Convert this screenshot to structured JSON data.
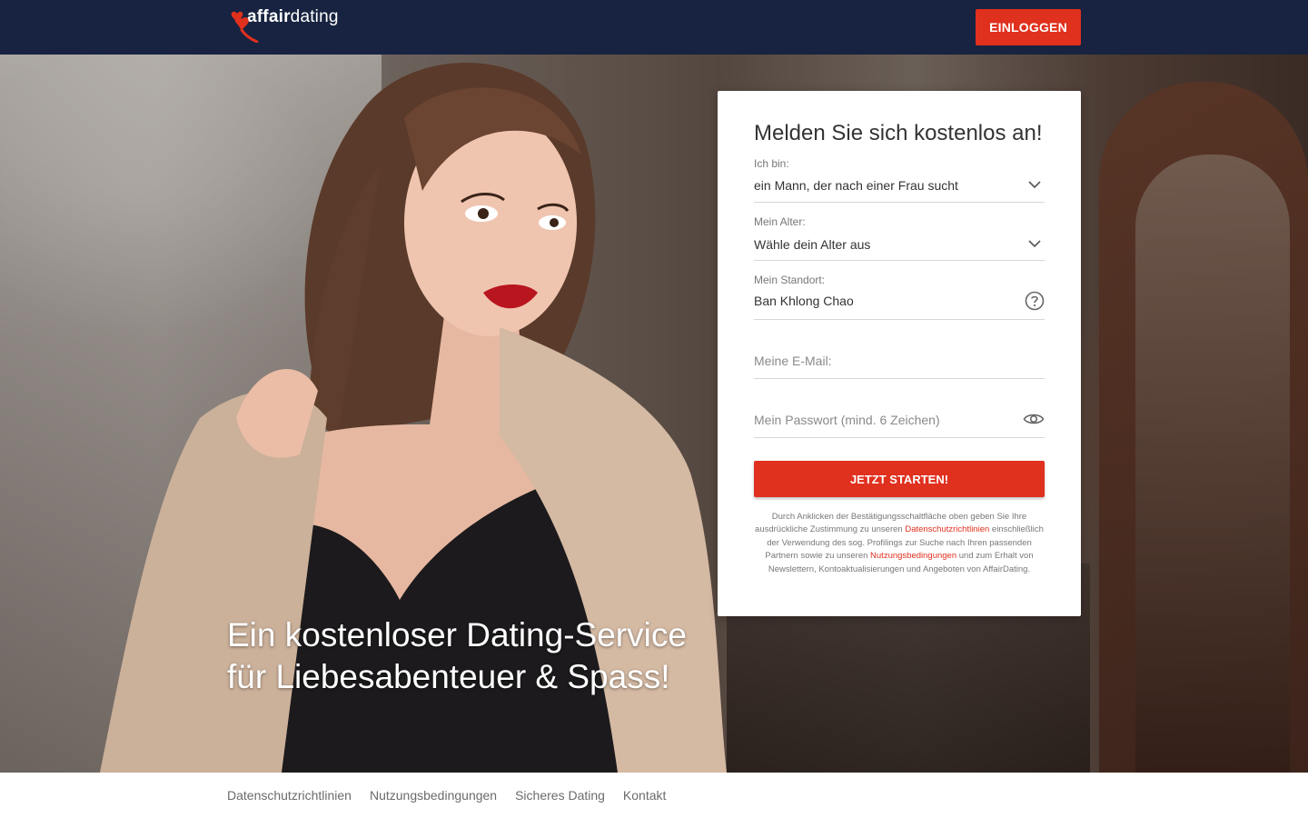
{
  "header": {
    "logo": {
      "brand_bold": "affair",
      "brand_light": "dating"
    },
    "login_label": "EINLOGGEN"
  },
  "hero": {
    "headline": "Ein kostenloser Dating-Service für Liebesabenteuer & Spass!"
  },
  "signup": {
    "title": "Melden Sie sich kostenlos an!",
    "gender": {
      "label": "Ich bin:",
      "value": "ein Mann, der nach einer Frau sucht"
    },
    "age": {
      "label": "Mein Alter:",
      "value": "Wähle dein Alter aus"
    },
    "location": {
      "label": "Mein Standort:",
      "value": "Ban Khlong Chao"
    },
    "email": {
      "placeholder": "Meine E-Mail:"
    },
    "password": {
      "placeholder": "Mein Passwort (mind. 6 Zeichen)"
    },
    "submit_label": "JETZT STARTEN!",
    "legal": {
      "part1": "Durch Anklicken der Bestätigungsschaltfläche oben geben Sie Ihre ausdrückliche Zustimmung zu unseren ",
      "link1": "Datenschutzrichtlinien",
      "part2": " einschließlich der Verwendung des sog. Profilings zur Suche nach Ihren passenden Partnern sowie zu unseren ",
      "link2": "Nutzungsbedingungen",
      "part3": " und zum Erhalt von Newslettern, Kontoaktualisierungen und Angeboten von AffairDating."
    }
  },
  "footer": {
    "links": [
      "Datenschutzrichtlinien",
      "Nutzungsbedingungen",
      "Sicheres Dating",
      "Kontakt"
    ]
  },
  "colors": {
    "header_bg": "#172340",
    "accent": "#e0301e"
  },
  "icons": {
    "logo": "heart-logo-icon",
    "dropdown": "chevron-down-icon",
    "help": "question-circle-icon",
    "show_password": "eye-icon"
  }
}
